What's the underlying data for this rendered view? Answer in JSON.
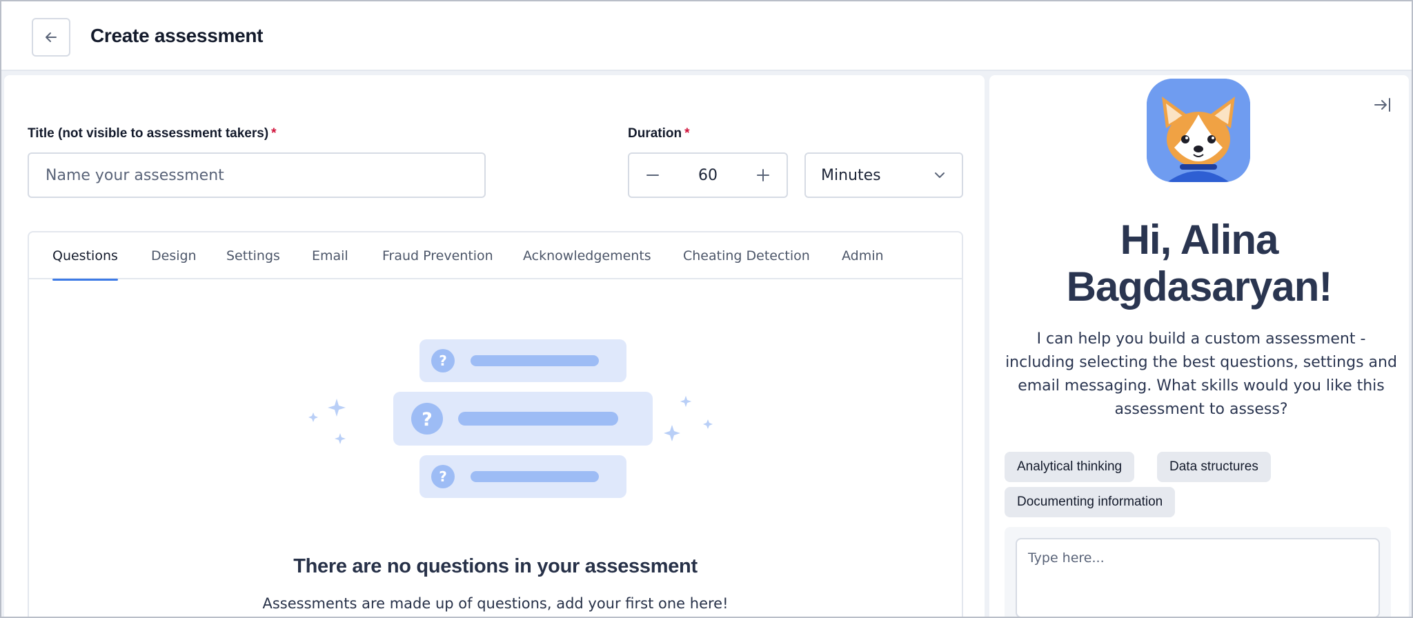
{
  "header": {
    "title": "Create assessment"
  },
  "form": {
    "title_label": "Title (not visible to assessment takers)",
    "title_required": "*",
    "title_placeholder": "Name your assessment",
    "duration_label": "Duration",
    "duration_required": "*",
    "duration_value": "60",
    "duration_unit": "Minutes"
  },
  "tabs": [
    {
      "label": "Questions",
      "active": true
    },
    {
      "label": "Design",
      "active": false
    },
    {
      "label": "Settings",
      "active": false
    },
    {
      "label": "Email",
      "active": false
    },
    {
      "label": "Fraud Prevention",
      "active": false
    },
    {
      "label": "Acknowledgements",
      "active": false
    },
    {
      "label": "Cheating Detection",
      "active": false
    },
    {
      "label": "Admin",
      "active": false
    }
  ],
  "empty_state": {
    "title": "There are no questions in your assessment",
    "subtitle": "Assessments are made up of questions, add your first one here!"
  },
  "assistant": {
    "greeting_line1": "Hi, Alina",
    "greeting_line2": "Bagdasaryan!",
    "intro": "I can help you build a custom assessment - including selecting the best questions, settings and email messaging. What skills would you like this assessment to assess?",
    "suggestions": [
      "Analytical thinking",
      "Data structures",
      "Documenting information"
    ],
    "input_placeholder": "Type here..."
  },
  "colors": {
    "accent": "#3d7ae6",
    "required": "#d0123a",
    "illustration": "#9dbcf5",
    "illustration_bg": "#dfe8fb"
  },
  "icons": {
    "back": "arrow-left-icon",
    "minus": "minus-icon",
    "plus": "plus-icon",
    "unit_dropdown": "chevron-down-icon",
    "collapse": "collapse-panel-icon",
    "avatar": "corgi-mascot-icon"
  }
}
